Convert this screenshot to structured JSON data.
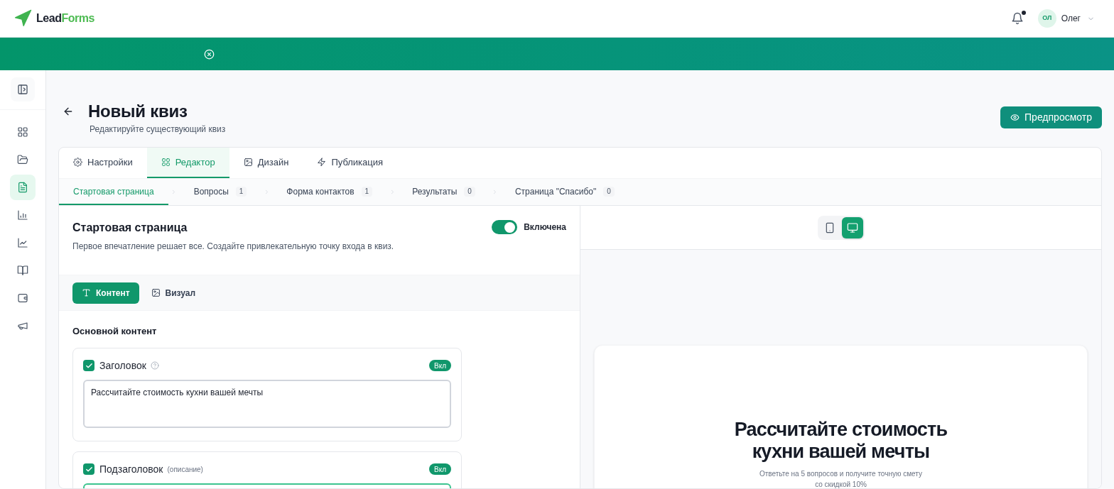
{
  "header": {
    "logo": {
      "word_1": "Lead",
      "word_2": "Forms"
    },
    "notifications": {
      "unread": true
    },
    "user": {
      "initials": "ОЛ",
      "name": "Олег"
    }
  },
  "banner": {
    "closable": true
  },
  "sidebar": {
    "items": [
      {
        "selected": false
      },
      {
        "selected": false
      },
      {
        "selected": true
      },
      {
        "selected": false
      },
      {
        "selected": false
      },
      {
        "selected": false
      },
      {
        "selected": false
      },
      {
        "selected": false
      }
    ]
  },
  "page": {
    "title": "Новый квиз",
    "subtitle": "Редактируйте существующий квиз",
    "preview_button": "Предпросмотр"
  },
  "tabs": [
    {
      "label": "Настройки",
      "selected": false
    },
    {
      "label": "Редактор",
      "selected": true
    },
    {
      "label": "Дизайн",
      "selected": false
    },
    {
      "label": "Публикация",
      "selected": false
    }
  ],
  "steps": [
    {
      "label": "Стартовая страница",
      "selected": true
    },
    {
      "label": "Вопросы",
      "count": "1",
      "selected": false
    },
    {
      "label": "Форма контактов",
      "count": "1",
      "selected": false
    },
    {
      "label": "Результаты",
      "count": "0",
      "selected": false
    },
    {
      "label": "Страница \"Спасибо\"",
      "count": "0",
      "selected": false
    }
  ],
  "section": {
    "title": "Стартовая страница",
    "description": "Первое впечатление решает все. Создайте привлекательную точку входа в квиз.",
    "enabled": true,
    "enabled_label": "Включена"
  },
  "content_tabs": [
    {
      "label": "Контент",
      "selected": true
    },
    {
      "label": "Визуал",
      "selected": false
    }
  ],
  "main_content": {
    "heading": "Основной контент",
    "fields": [
      {
        "label": "Заголовок",
        "help": true,
        "checked": true,
        "badge": "Вкл",
        "value": "Рассчитайте стоимость кухни вашей мечты",
        "focused": false
      },
      {
        "label": "Подзаголовок",
        "note": "(описание)",
        "help": false,
        "checked": true,
        "badge": "Вкл",
        "focused": true
      }
    ]
  },
  "preview": {
    "devices": [
      {
        "selected": false
      },
      {
        "selected": true
      }
    ],
    "title_lines": [
      "Рассчитайте стоимость",
      "кухни вашей мечты"
    ],
    "subtitle_lines": [
      "Ответьте на 5 вопросов и получите точную смету",
      "со скидкой 10%"
    ]
  }
}
